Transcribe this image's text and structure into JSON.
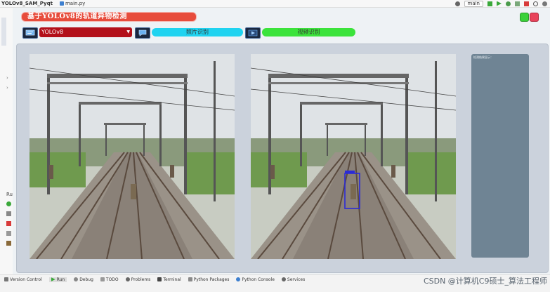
{
  "ide": {
    "project_name": "YOLOv8_SAM_Pyqt",
    "open_file": "main.py",
    "branch": "main",
    "run_label": "Run"
  },
  "app": {
    "title": "基于YOLOv8的轨道异物检测",
    "model_value": "YOLOv8",
    "image_button_label": "照片识别",
    "video_button_label": "视频识别",
    "info_text": "检测结果显示："
  },
  "colors": {
    "title_bg": "#e74c3c",
    "model_select_bg": "#b3101a",
    "image_button_bg": "#1fd3f0",
    "video_button_bg": "#3be33b",
    "info_panel_bg": "#6f8494",
    "detection_box": "#2b2bd6"
  },
  "bottom_tabs": [
    {
      "label": "Version Control",
      "icon": "branch-icon"
    },
    {
      "label": "Run",
      "icon": "play-icon",
      "active": true
    },
    {
      "label": "Debug",
      "icon": "bug-icon"
    },
    {
      "label": "TODO",
      "icon": "list-icon"
    },
    {
      "label": "Problems",
      "icon": "warning-icon"
    },
    {
      "label": "Terminal",
      "icon": "terminal-icon"
    },
    {
      "label": "Python Packages",
      "icon": "package-icon"
    },
    {
      "label": "Python Console",
      "icon": "python-icon"
    },
    {
      "label": "Services",
      "icon": "services-icon"
    }
  ],
  "watermark": "CSDN @计算机C9硕士_算法工程师"
}
